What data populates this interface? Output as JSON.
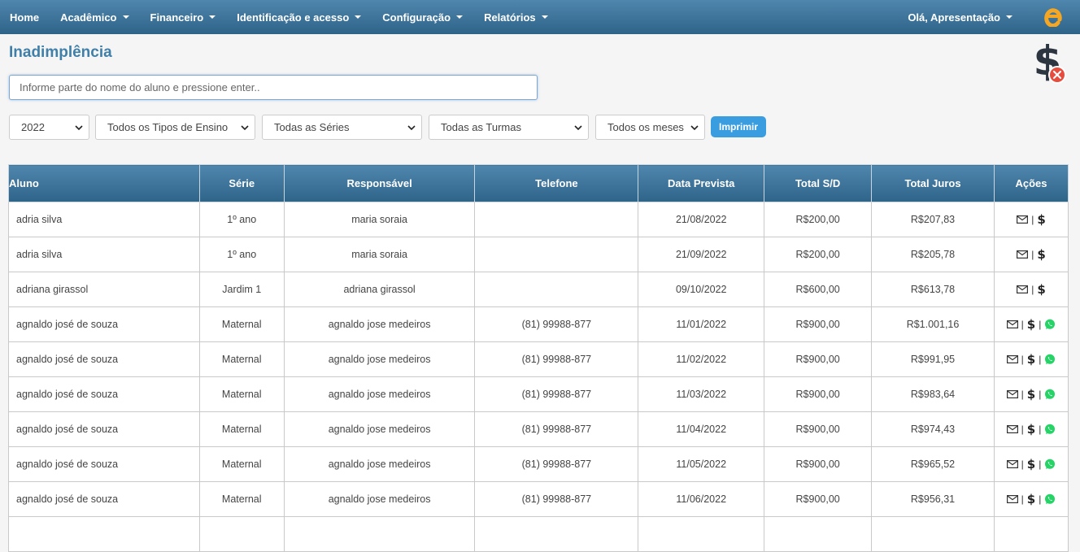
{
  "nav": {
    "items": [
      {
        "label": "Home",
        "dropdown": false
      },
      {
        "label": "Acadêmico",
        "dropdown": true
      },
      {
        "label": "Financeiro",
        "dropdown": true
      },
      {
        "label": "Identificação e acesso",
        "dropdown": true
      },
      {
        "label": "Configuração",
        "dropdown": true
      },
      {
        "label": "Relatórios",
        "dropdown": true
      }
    ],
    "user_greeting": "Olá, Apresentação",
    "logo_icon": "e-logo-icon",
    "brand_color": "#f5a623"
  },
  "page": {
    "title": "Inadimplência",
    "title_color": "#3f7fa8",
    "header_icon": "dollar-overdue-icon"
  },
  "search": {
    "placeholder": "Informe parte do nome do aluno e pressione enter.."
  },
  "filters": {
    "year": "2022",
    "tipo_ensino": "Todos os Tipos de Ensino",
    "serie": "Todas as Séries",
    "turma": "Todas as Turmas",
    "mes": "Todos os meses",
    "print_label": "Imprimir",
    "print_color": "#3a9de0"
  },
  "table": {
    "headers": [
      "Aluno",
      "Série",
      "Responsável",
      "Telefone",
      "Data Prevista",
      "Total S/D",
      "Total Juros",
      "Ações"
    ],
    "rows": [
      {
        "aluno": "adria silva",
        "serie": "1º ano",
        "responsavel": "maria soraia",
        "telefone": "",
        "data": "21/08/2022",
        "total": "R$200,00",
        "juros": "R$207,83",
        "whatsapp": false
      },
      {
        "aluno": "adria silva",
        "serie": "1º ano",
        "responsavel": "maria soraia",
        "telefone": "",
        "data": "21/09/2022",
        "total": "R$200,00",
        "juros": "R$205,78",
        "whatsapp": false
      },
      {
        "aluno": "adriana girassol",
        "serie": "Jardim 1",
        "responsavel": "adriana girassol",
        "telefone": "",
        "data": "09/10/2022",
        "total": "R$600,00",
        "juros": "R$613,78",
        "whatsapp": false
      },
      {
        "aluno": "agnaldo josé de souza",
        "serie": "Maternal",
        "responsavel": "agnaldo jose medeiros",
        "telefone": "(81) 99988-877",
        "data": "11/01/2022",
        "total": "R$900,00",
        "juros": "R$1.001,16",
        "whatsapp": true
      },
      {
        "aluno": "agnaldo josé de souza",
        "serie": "Maternal",
        "responsavel": "agnaldo jose medeiros",
        "telefone": "(81) 99988-877",
        "data": "11/02/2022",
        "total": "R$900,00",
        "juros": "R$991,95",
        "whatsapp": true
      },
      {
        "aluno": "agnaldo josé de souza",
        "serie": "Maternal",
        "responsavel": "agnaldo jose medeiros",
        "telefone": "(81) 99988-877",
        "data": "11/03/2022",
        "total": "R$900,00",
        "juros": "R$983,64",
        "whatsapp": true
      },
      {
        "aluno": "agnaldo josé de souza",
        "serie": "Maternal",
        "responsavel": "agnaldo jose medeiros",
        "telefone": "(81) 99988-877",
        "data": "11/04/2022",
        "total": "R$900,00",
        "juros": "R$974,43",
        "whatsapp": true
      },
      {
        "aluno": "agnaldo josé de souza",
        "serie": "Maternal",
        "responsavel": "agnaldo jose medeiros",
        "telefone": "(81) 99988-877",
        "data": "11/05/2022",
        "total": "R$900,00",
        "juros": "R$965,52",
        "whatsapp": true
      },
      {
        "aluno": "agnaldo josé de souza",
        "serie": "Maternal",
        "responsavel": "agnaldo jose medeiros",
        "telefone": "(81) 99988-877",
        "data": "11/06/2022",
        "total": "R$900,00",
        "juros": "R$956,31",
        "whatsapp": true
      },
      {
        "aluno": "",
        "serie": "",
        "responsavel": "",
        "telefone": "",
        "data": "",
        "total": "",
        "juros": "",
        "whatsapp": false
      }
    ],
    "dollar_symbol": "$",
    "action_separator": "|"
  }
}
